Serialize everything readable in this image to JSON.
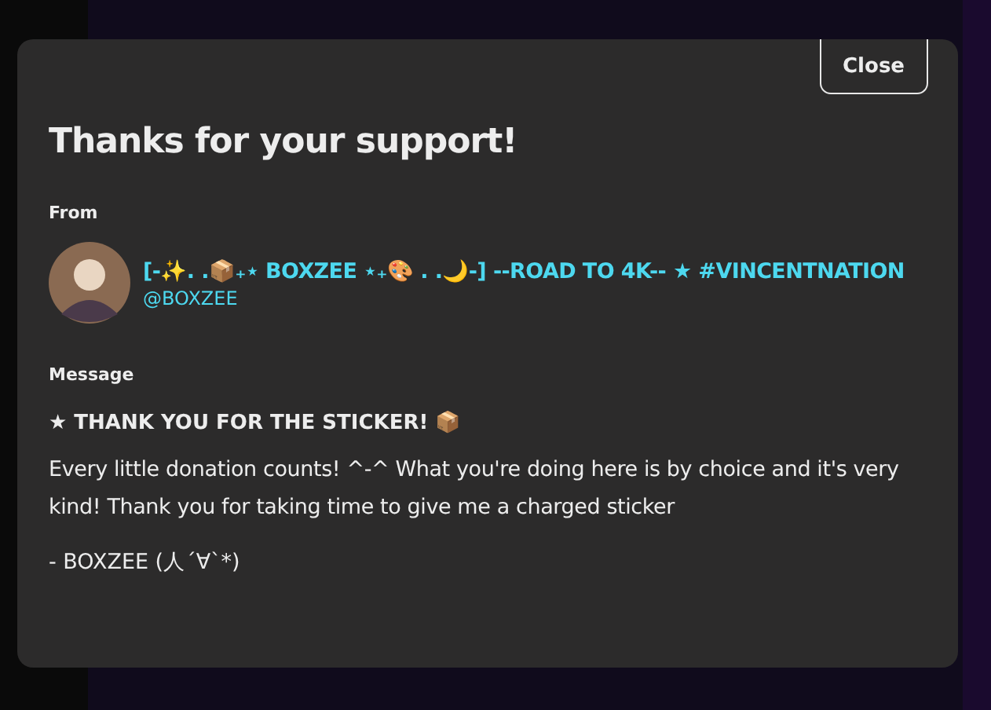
{
  "dialog": {
    "close_button": "Close",
    "title": "Thanks for your support!",
    "from": {
      "label": "From",
      "display_name": "[-✨. .📦₊⋆ BOXZEE ⋆₊🎨 . .🌙-] --ROAD TO 4K-- ★ #VINCENTNATION",
      "handle": "@BOXZEE"
    },
    "message": {
      "label": "Message",
      "headline": "★ THANK YOU FOR THE STICKER! 📦",
      "body": "Every little donation counts! ^-^ What you're doing here is by choice and it's very kind! Thank you for taking time to give me a charged sticker",
      "signature": "- BOXZEE  (人´∀`*)"
    }
  }
}
